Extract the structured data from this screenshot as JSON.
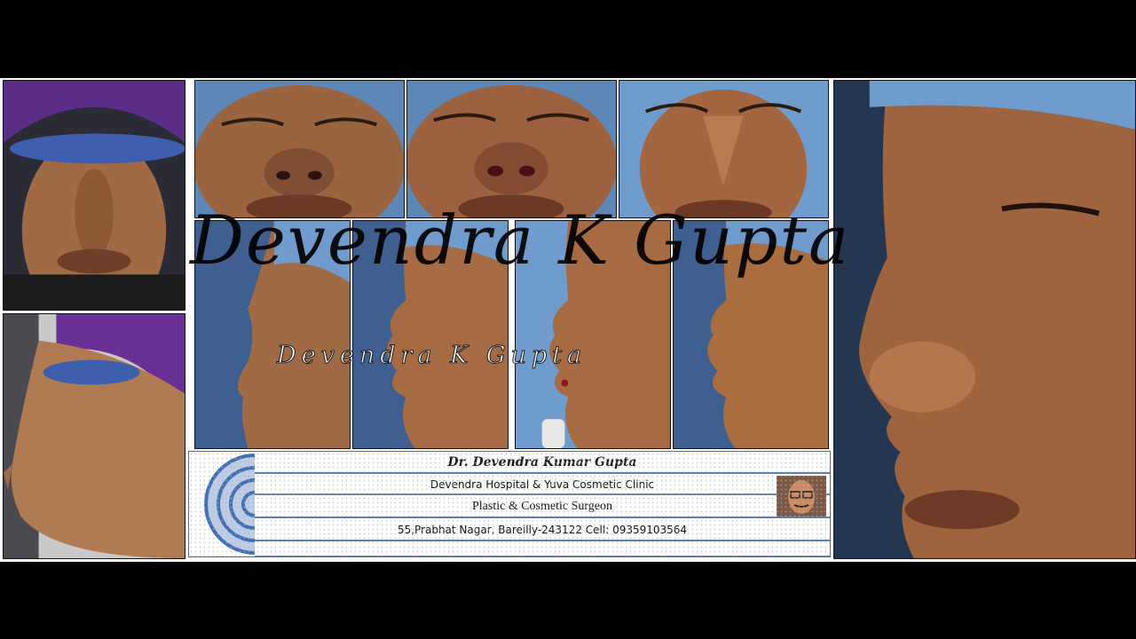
{
  "watermark": {
    "main": "Devendra K Gupta",
    "secondary": "Devendra K Gupta"
  },
  "clinic_card": {
    "doctor_name": "Dr. Devendra Kumar Gupta",
    "hospital": "Devendra Hospital & Yuva Cosmetic Clinic",
    "specialty": "Plastic & Cosmetic Surgeon",
    "address": "55,Prabhat Nagar, Bareilly-243122 Cell: 09359103564"
  },
  "colors": {
    "background": "#000000",
    "surgical_drape": "#6f9ccc",
    "skin": "#a06a45",
    "card_rule": "#5b7fb1",
    "eye_bar": "#3d5fae"
  },
  "photos": [
    "pre-op-frontal",
    "pre-op-profile",
    "basal-view-pre",
    "basal-view-incision",
    "oblique-top-view",
    "profile-1",
    "profile-2",
    "profile-3",
    "profile-4",
    "close-up-profile"
  ]
}
